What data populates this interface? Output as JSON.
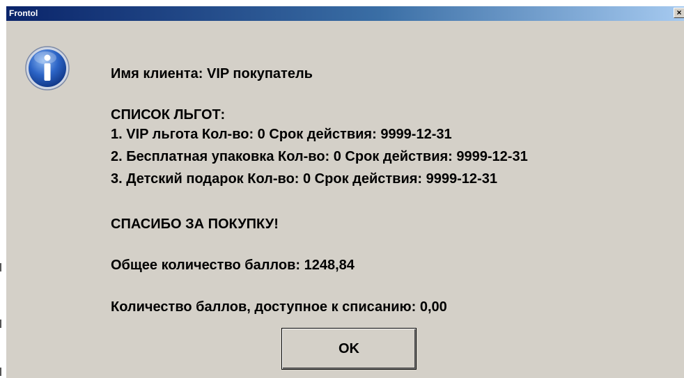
{
  "window": {
    "title": "Frontol",
    "close_label": "×"
  },
  "icon": {
    "name": "info-icon",
    "glyph": "i",
    "color": "#1f55b8"
  },
  "message": {
    "client": "Имя клиента: VIP покупатель",
    "list_header": "СПИСОК ЛЬГОТ:",
    "benefits": [
      "1. VIP льгота Кол-во: 0 Срок действия: 9999-12-31",
      "2. Бесплатная упаковка Кол-во: 0 Срок действия: 9999-12-31",
      "3. Детский подарок Кол-во: 0 Срок действия: 9999-12-31"
    ],
    "thanks": "СПАСИБО ЗА ПОКУПКУ!",
    "total_points": "Общее количество баллов: 1248,84",
    "available_points": "Количество баллов, доступное к списанию: 0,00"
  },
  "buttons": {
    "ok": "OK"
  }
}
